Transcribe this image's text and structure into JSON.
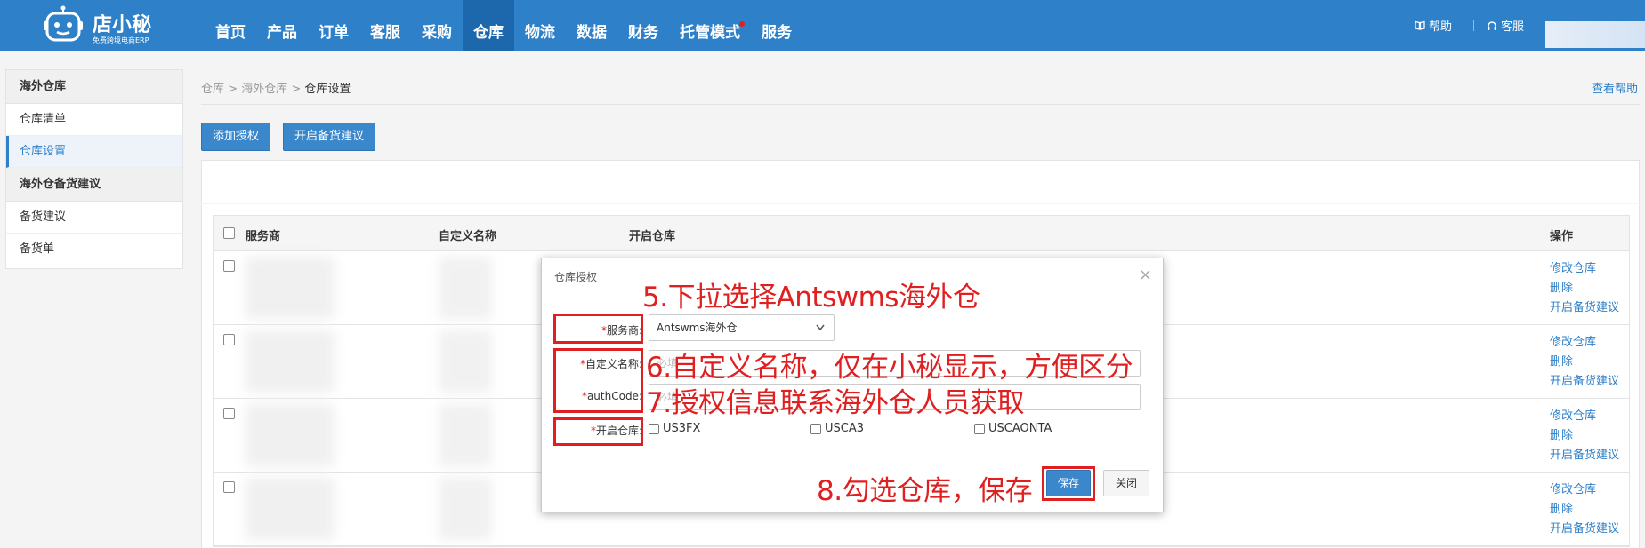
{
  "logo": {
    "name": "店小秘",
    "slogan": "免费跨境电商ERP"
  },
  "nav": {
    "items": [
      "首页",
      "产品",
      "订单",
      "客服",
      "采购",
      "仓库",
      "物流",
      "数据",
      "财务",
      "托管模式",
      "服务"
    ],
    "active_index": 5,
    "dot_index": 9
  },
  "header": {
    "help": "帮助",
    "service": "客服"
  },
  "sidebar": {
    "group1_title": "海外仓库",
    "group1_items": [
      "仓库清单",
      "仓库设置"
    ],
    "group2_title": "海外仓备货建议",
    "group2_items": [
      "备货建议",
      "备货单"
    ]
  },
  "breadcrumb": {
    "item1": "仓库",
    "item2": "海外仓库",
    "current": "仓库设置",
    "sep": ">"
  },
  "help_link": "查看帮助",
  "toolbar": {
    "add_auth": "添加授权",
    "enable_stock": "开启备货建议"
  },
  "table": {
    "col_provider": "服务商",
    "col_custom_name": "自定义名称",
    "col_enabled_wh": "开启仓库",
    "col_ops": "操作",
    "row_ops": [
      "修改仓库",
      "删除",
      "开启备货建议"
    ]
  },
  "dialog": {
    "title": "仓库授权",
    "close_glyph": "×",
    "provider_label": "服务商:",
    "provider_value": "Antswms海外仓",
    "custom_name_label": "自定义名称:",
    "custom_name_placeholder": "必填",
    "auth_label": "authCode:",
    "auth_placeholder": "必填",
    "warehouse_label": "开启仓库:",
    "warehouses": [
      "US3FX",
      "USCA3",
      "USCAONTA"
    ],
    "save": "保存",
    "close": "关闭"
  },
  "annotations": {
    "step5": "5.下拉选择Antswms海外仓",
    "step6": "6.自定义名称，仅在小秘显示，方便区分",
    "step7": "7.授权信息联系海外仓人员获取",
    "step8": "8.勾选仓库，保存"
  },
  "colors": {
    "topbar": "#2e80c9",
    "annotation_red": "#e02020",
    "link_blue": "#2e80c9"
  }
}
